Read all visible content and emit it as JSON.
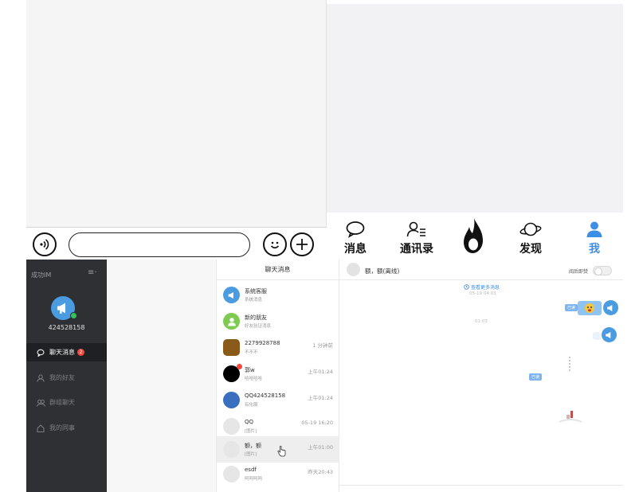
{
  "mobile_chat": {
    "input_value": "",
    "icons": {
      "voice": "voice-icon",
      "emoji": "emoji-icon",
      "plus": "plus-icon"
    }
  },
  "mobile_tabbar": {
    "tabs": [
      {
        "label": "消息",
        "icon": "chat-bubble-icon"
      },
      {
        "label": "通讯录",
        "icon": "contacts-icon"
      },
      {
        "label": "",
        "icon": "flame-icon"
      },
      {
        "label": "发现",
        "icon": "planet-icon"
      },
      {
        "label": "我",
        "icon": "person-icon"
      }
    ],
    "active_color": "#3d8fe6"
  },
  "desktop": {
    "sidebar": {
      "app_name": "成功IM",
      "menu_glyph": "≡·",
      "user_id": "424528158",
      "items": [
        {
          "label": "聊天消息",
          "badge": "2",
          "icon": "chat-icon"
        },
        {
          "label": "我的好友",
          "icon": "friend-icon"
        },
        {
          "label": "群组聊天",
          "icon": "group-icon"
        },
        {
          "label": "我的同事",
          "icon": "home-icon"
        }
      ]
    },
    "chat_list": {
      "title": "聊天消息",
      "items": [
        {
          "name": "系统客服",
          "preview": "系统消息",
          "time": ""
        },
        {
          "name": "新的朋友",
          "preview": "好友验证消息",
          "time": ""
        },
        {
          "name": "2279928788",
          "preview": "不不不",
          "time": "1 分钟前"
        },
        {
          "name": "郭w",
          "preview": "哈哈哈哈",
          "time": "上午01:24"
        },
        {
          "name": "QQ424528158",
          "preview": "有化服",
          "time": "上午01:24"
        },
        {
          "name": "QQ",
          "preview": "[图片]",
          "time": "05-19 16:20"
        },
        {
          "name": "额，额",
          "preview": "[图片]",
          "time": "上午01:00"
        },
        {
          "name": "esdf",
          "preview": "呵呵呵呵",
          "time": "昨天20:43"
        }
      ]
    },
    "chat_window": {
      "title": "额，额(离线)",
      "burn_label": "阅后即焚",
      "more_label": "查看更多消息",
      "time_1": "05-19 04:03",
      "time_2": "01:03",
      "read_tag": "已读"
    },
    "colors": {
      "sidebar_bg": "#2e3033",
      "accent": "#4a9be0",
      "badge": "#f5493c"
    }
  }
}
